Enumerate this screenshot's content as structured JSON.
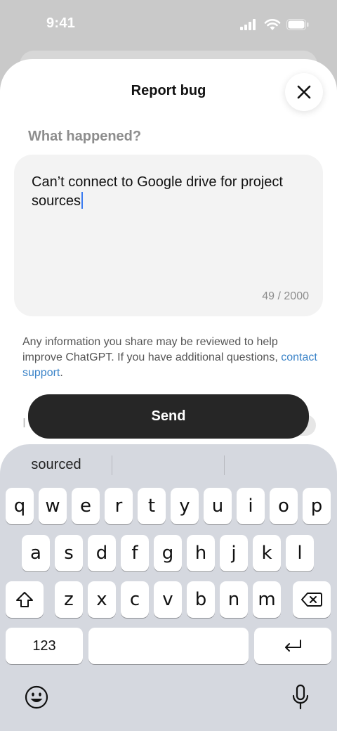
{
  "status_bar": {
    "time": "9:41"
  },
  "sheet": {
    "title": "Report bug",
    "section_label": "What happened?",
    "text_value": "Can’t connect to Google drive for project sources",
    "char_count": "49 / 2000",
    "disclaimer_text": "Any information you share may be reviewed to help improve ChatGPT. If you have additional questions, ",
    "contact_link": "contact support",
    "disclaimer_end": ".",
    "send_label": "Send",
    "ghost_row_text": "I"
  },
  "keyboard": {
    "suggestions": [
      "sourced",
      "",
      ""
    ],
    "row1": [
      "q",
      "w",
      "e",
      "r",
      "t",
      "y",
      "u",
      "i",
      "o",
      "p"
    ],
    "row2": [
      "a",
      "s",
      "d",
      "f",
      "g",
      "h",
      "j",
      "k",
      "l"
    ],
    "row3": [
      "z",
      "x",
      "c",
      "v",
      "b",
      "n",
      "m"
    ],
    "numbers_label": "123"
  },
  "icons": {
    "status": [
      "signal-icon",
      "wifi-icon",
      "battery-icon"
    ],
    "close": "close-icon",
    "shift": "shift-icon",
    "delete": "delete-icon",
    "return": "return-icon",
    "emoji": "emoji-icon",
    "mic": "microphone-icon"
  },
  "colors": {
    "send_bg": "#262626",
    "link": "#3a83c8",
    "caret": "#3b7bf0"
  }
}
